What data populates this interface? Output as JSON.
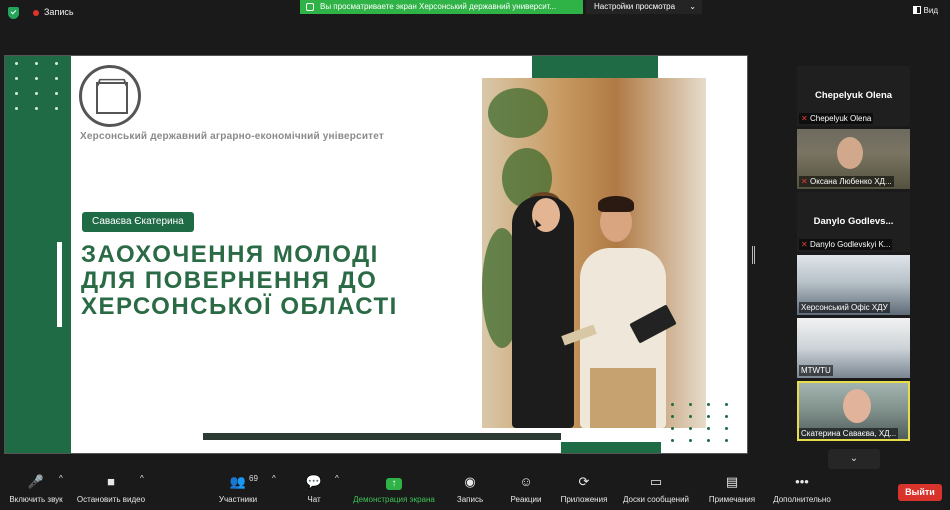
{
  "topbar": {
    "record_label": "Запись",
    "share_banner": "Вы просматриваете экран Херсонський державний университ...",
    "view_settings": "Настройки просмотра",
    "view_button": "Вид"
  },
  "slide": {
    "university": "Херсонський державний аграрно-економічний університет",
    "author": "Саваєва Єкатерина",
    "headline_1": "ЗАОХОЧЕННЯ МОЛОДІ",
    "headline_2": "ДЛЯ ПОВЕРНЕННЯ ДО",
    "headline_3": "ХЕРСОНСЬКОЇ ОБЛАСТІ"
  },
  "participants": [
    {
      "display": "Chepelyuk Olena",
      "caption": "Chepelyuk Olena",
      "muted": true,
      "video": false
    },
    {
      "display": "",
      "caption": "Оксана Любенко ХД...",
      "muted": true,
      "video": true
    },
    {
      "display": "Danylo  Godlevs...",
      "caption": "Danylo Godlevskyi  K...",
      "muted": true,
      "video": false
    },
    {
      "display": "",
      "caption": "Херсонський Офіс ХДУ",
      "muted": false,
      "video": true
    },
    {
      "display": "",
      "caption": "MTWTU",
      "muted": false,
      "video": true
    },
    {
      "display": "",
      "caption": "Скатерина Саваєва, ХД...",
      "muted": false,
      "video": true,
      "active": true
    }
  ],
  "toolbar": {
    "unmute": "Включить звук",
    "start_video": "Остановить видео",
    "participants": "Участники",
    "participants_count": "69",
    "chat": "Чат",
    "share_screen": "Демонстрация экрана",
    "record": "Запись",
    "reactions": "Реакции",
    "apps": "Приложения",
    "whiteboards": "Доски сообщений",
    "notes": "Примечания",
    "more": "Дополнительно",
    "leave": "Выйти"
  },
  "colors": {
    "brand_green": "#1f6b45",
    "share_green": "#2fb347",
    "leave_red": "#d9342b",
    "active_speaker": "#e6dd49"
  }
}
